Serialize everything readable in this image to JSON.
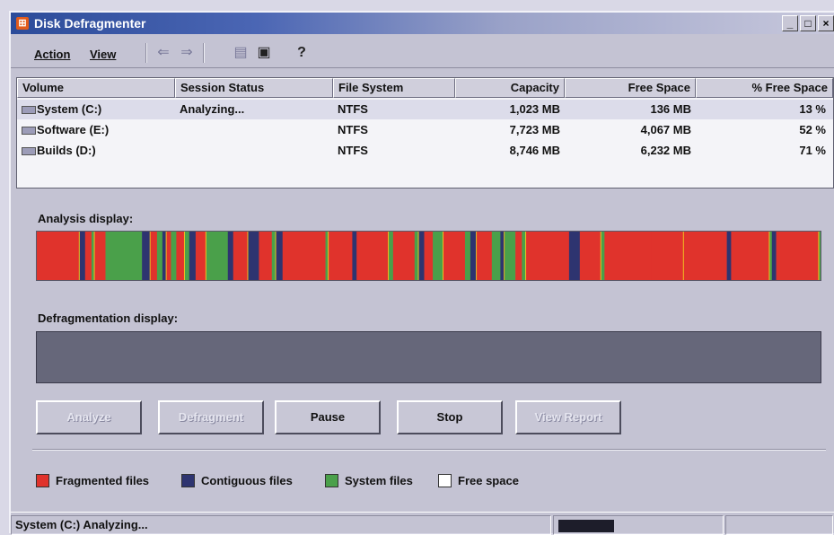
{
  "window": {
    "title": "Disk Defragmenter",
    "controls": [
      "_",
      "□",
      "×"
    ]
  },
  "menu": {
    "items": [
      "Action",
      "View"
    ],
    "toolbar_icons": [
      "back-arrow-icon",
      "forward-arrow-icon",
      "properties-icon",
      "show-hide-icon",
      "help-icon"
    ]
  },
  "volume_list": {
    "columns": [
      "Volume",
      "Session Status",
      "File System",
      "Capacity",
      "Free Space",
      "% Free Space"
    ],
    "rows": [
      {
        "volume": "System (C:)",
        "status": "Analyzing...",
        "fs": "NTFS",
        "capacity": "1,023 MB",
        "free": "136 MB",
        "pct": "13 %"
      },
      {
        "volume": "Software (E:)",
        "status": "",
        "fs": "NTFS",
        "capacity": "7,723 MB",
        "free": "4,067 MB",
        "pct": "52 %"
      },
      {
        "volume": "Builds (D:)",
        "status": "",
        "fs": "NTFS",
        "capacity": "8,746 MB",
        "free": "6,232 MB",
        "pct": "71 %"
      }
    ]
  },
  "analysis": {
    "label": "Analysis display:"
  },
  "defrag": {
    "label": "Defragmentation display:"
  },
  "buttons": {
    "analyze": "Analyze",
    "defragment": "Defragment",
    "pause": "Pause",
    "stop": "Stop",
    "view_report": "View Report"
  },
  "legend": {
    "fragmented": "Fragmented files",
    "contiguous": "Contiguous files",
    "system": "System files",
    "free": "Free space"
  },
  "colors": {
    "fragmented": "#e0332c",
    "contiguous": "#2e3470",
    "system": "#4aa04a",
    "free": "#ffffff"
  },
  "status_bar": {
    "text": "System (C:) Analyzing..."
  }
}
